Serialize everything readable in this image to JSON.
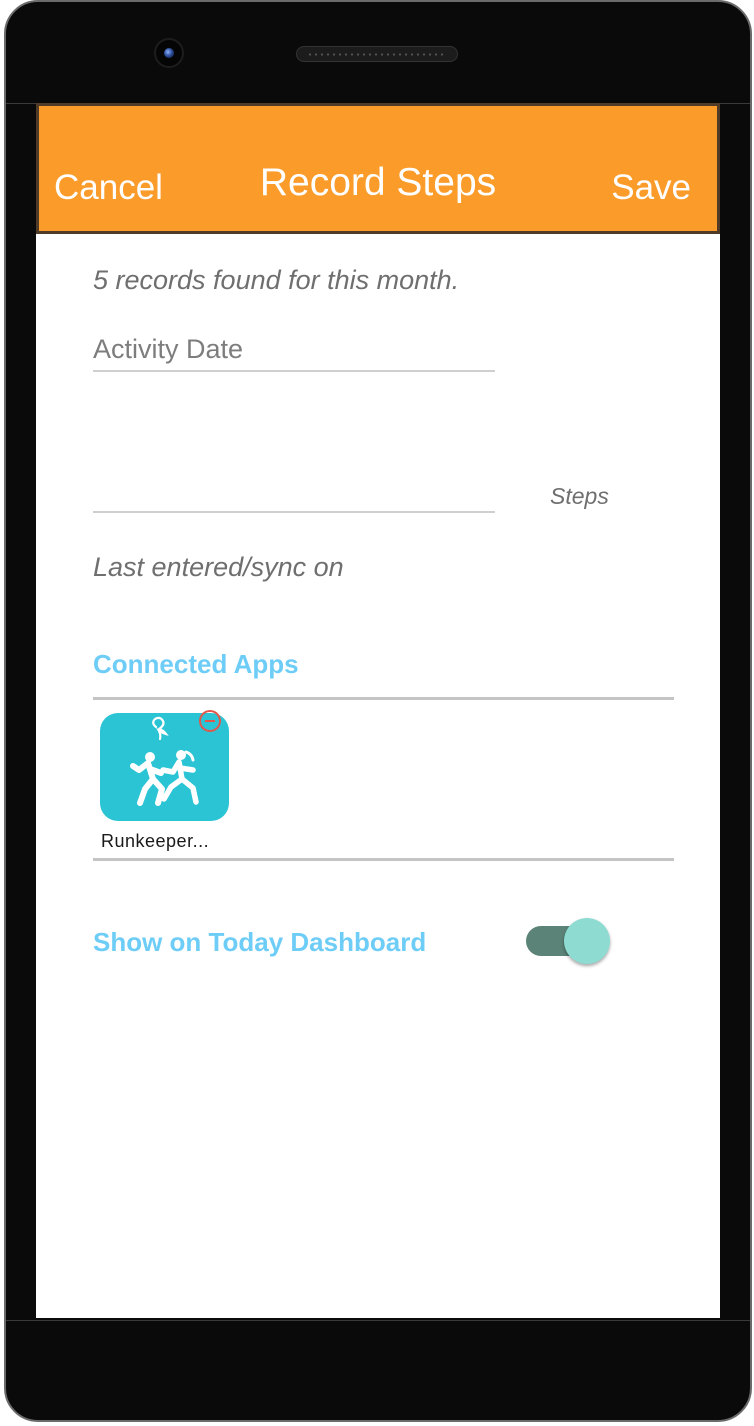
{
  "header": {
    "cancel_label": "Cancel",
    "title": "Record Steps",
    "save_label": "Save"
  },
  "form": {
    "records_found": "5 records found for this month.",
    "activity_date_placeholder": "Activity Date",
    "steps_value": "",
    "steps_label": "Steps",
    "last_entered": "Last entered/sync on"
  },
  "connected_apps": {
    "title": "Connected Apps",
    "apps": [
      {
        "name": "Runkeeper...",
        "icon": "runkeeper-runners-icon",
        "color": "#2bc4d4"
      }
    ]
  },
  "dashboard": {
    "title": "Show on Today Dashboard",
    "toggle_on": true
  },
  "colors": {
    "header": "#fa9b2a",
    "accent_blue": "#6ecdf7",
    "toggle_track": "#5b8377",
    "toggle_knob": "#8edbd2",
    "remove_badge": "#e2574c"
  }
}
